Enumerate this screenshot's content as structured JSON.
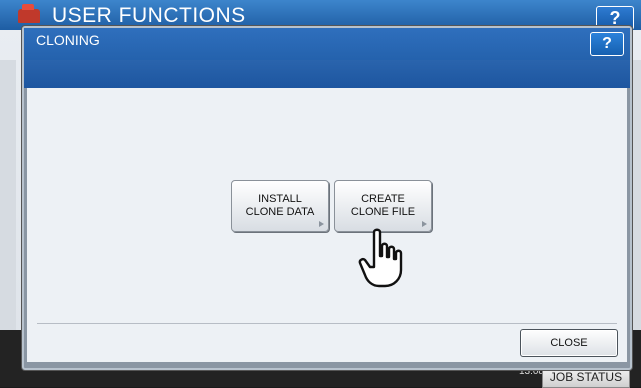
{
  "background": {
    "title": "USER FUNCTIONS",
    "help_label": "?",
    "footer_time": "13:08",
    "job_status_label": "JOB STATUS"
  },
  "dialog": {
    "title": "CLONING",
    "help_label": "?",
    "buttons": [
      {
        "line1": "INSTALL",
        "line2": "CLONE DATA"
      },
      {
        "line1": "CREATE",
        "line2": "CLONE FILE"
      }
    ],
    "close_label": "CLOSE"
  },
  "icons": {
    "pointer": "hand-pointer-icon",
    "logo": "printer-logo-icon",
    "submenu_arrow": "right-arrow-icon"
  },
  "colors": {
    "title_bar": "#2462ad",
    "panel_bg": "#edf1f5",
    "button_bg": "#ffffff"
  }
}
